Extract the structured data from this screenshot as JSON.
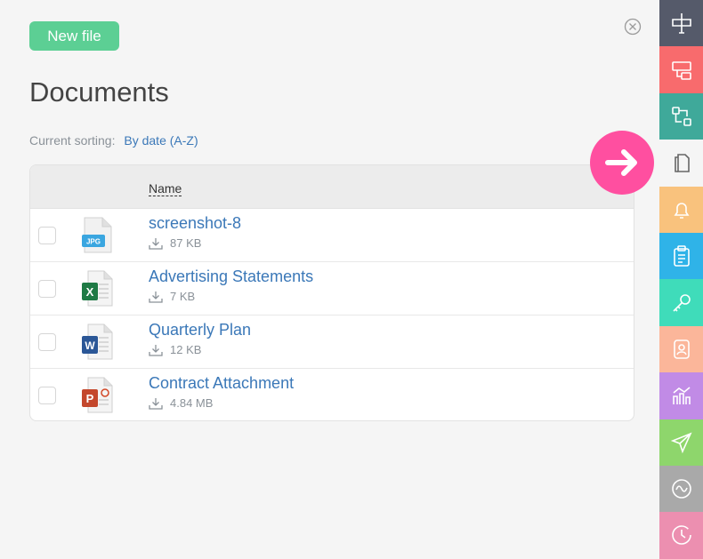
{
  "toolbar": {
    "new_file_label": "New file"
  },
  "page": {
    "title": "Documents"
  },
  "sorting": {
    "label": "Current sorting:",
    "value": "By date (A-Z)"
  },
  "table": {
    "column_name": "Name",
    "rows": [
      {
        "name": "screenshot-8",
        "size": "87 KB",
        "icon": "jpg-file-icon"
      },
      {
        "name": "Advertising Statements",
        "size": "7 KB",
        "icon": "excel-file-icon"
      },
      {
        "name": "Quarterly Plan",
        "size": "12 KB",
        "icon": "word-file-icon"
      },
      {
        "name": "Contract Attachment",
        "size": "4.84 MB",
        "icon": "powerpoint-file-icon"
      }
    ]
  },
  "sidebar": {
    "items": [
      {
        "icon": "signpost-icon",
        "color": "#555a6a"
      },
      {
        "icon": "forms-icon",
        "color": "#f86b6d"
      },
      {
        "icon": "workflow-icon",
        "color": "#3fa99a"
      },
      {
        "icon": "documents-icon",
        "color": "#f5f5f5"
      },
      {
        "icon": "bell-icon",
        "color": "#f9c27d"
      },
      {
        "icon": "clipboard-icon",
        "color": "#2fb3e8"
      },
      {
        "icon": "key-icon",
        "color": "#3fdcba"
      },
      {
        "icon": "contact-icon",
        "color": "#fbb69a"
      },
      {
        "icon": "chart-icon",
        "color": "#c18be6"
      },
      {
        "icon": "paper-plane-icon",
        "color": "#8ed66c"
      },
      {
        "icon": "wave-icon",
        "color": "#a9a9a9"
      },
      {
        "icon": "clock-icon",
        "color": "#ec8fb0"
      }
    ]
  },
  "colors": {
    "accent": "#5ccf94",
    "link": "#3b78b8",
    "pointer": "#ff4fa0"
  }
}
